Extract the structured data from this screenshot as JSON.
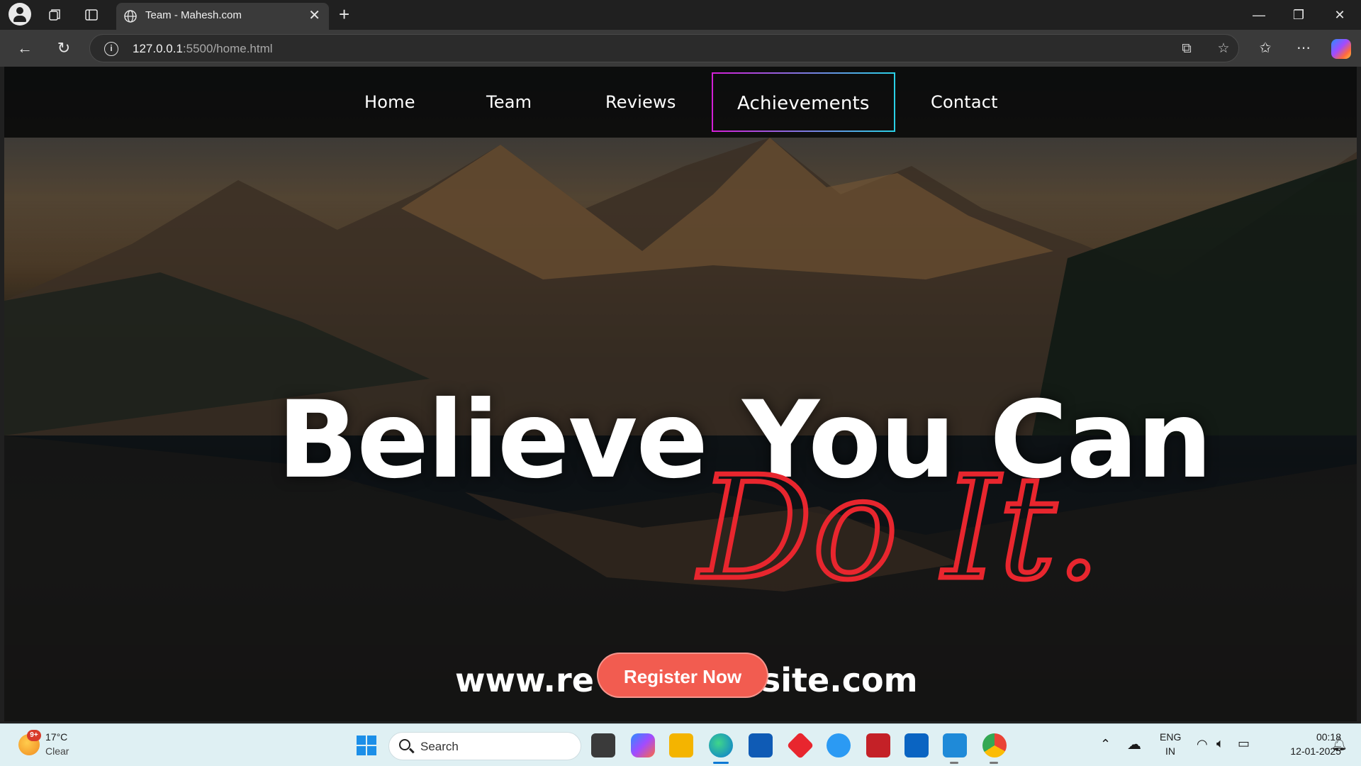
{
  "browser": {
    "tab_title": "Team - Mahesh.com",
    "url_host": "127.0.0.1",
    "url_path": ":5500/home.html"
  },
  "site": {
    "nav": [
      "Home",
      "Team",
      "Reviews",
      "Achievements",
      "Contact"
    ],
    "active_nav": "Achievements",
    "headline": "Believe You Can",
    "script_text": "Do It.",
    "website_left": "www.re",
    "website_right": "site.com",
    "register_label": "Register Now",
    "accent_colors": {
      "register": "#f25c50",
      "script": "#e8262e",
      "active_border_start": "#d21fd6",
      "active_border_end": "#2ad0e6"
    }
  },
  "taskbar": {
    "weather_badge": "9+",
    "weather_temp": "17°C",
    "weather_cond": "Clear",
    "search_label": "Search",
    "lang_1": "ENG",
    "lang_2": "IN",
    "time": "00:18",
    "date": "12-01-2025"
  }
}
